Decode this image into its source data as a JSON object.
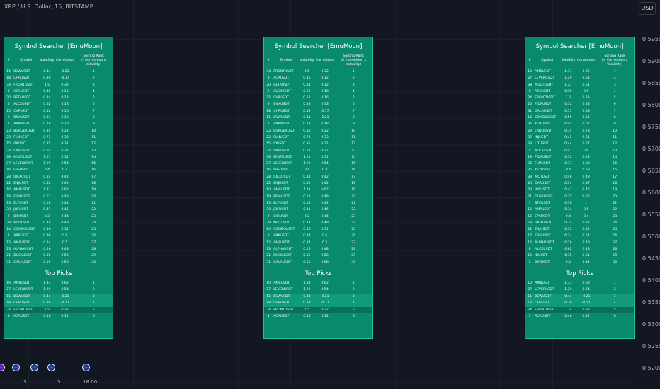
{
  "header": {
    "title": "XRP / U.S. Dollar, 15, BITSTAMP",
    "currency": "USD"
  },
  "price_axis": [
    "0.59500",
    "0.59000",
    "0.58500",
    "0.58000",
    "0.57500",
    "0.57000",
    "0.56500",
    "0.56000",
    "0.55500",
    "0.55000",
    "0.54500",
    "0.54000",
    "0.53500",
    "0.53000",
    "0.52500",
    "0.52000"
  ],
  "time_axis": [
    "3",
    "5",
    "18:00"
  ],
  "panels": [
    {
      "title": "Symbol Searcher [EmuMoon]",
      "cols": [
        "#",
        "Symbol",
        "Volatility",
        "Correlation",
        "Sorting Rank\n(- Correlation x Volatility)"
      ],
      "rows": [
        [
          "11",
          "BSWUSDT",
          "0.44",
          "-0.21",
          "1"
        ],
        [
          "18",
          "CHRUSDT",
          "0.39",
          "-0.17",
          "2"
        ],
        [
          "34",
          "FRONTUSDT",
          "1.5",
          "0.32",
          "3"
        ],
        [
          "3",
          "ACAUSDT",
          "0.46",
          "0.12",
          "4"
        ],
        [
          "20",
          "BETAUSDT",
          "0.34",
          "0.12",
          "5"
        ],
        [
          "6",
          "ALCXUSDT",
          "0.62",
          "0.18",
          "6"
        ],
        [
          "25",
          "CVPUSDT",
          "0.52",
          "0.16",
          "7"
        ],
        [
          "9",
          "BNXUSDT",
          "0.33",
          "0.13",
          "8"
        ],
        [
          "7",
          "ARPAUSDT",
          "0.28",
          "0.18",
          "9"
        ],
        [
          "23",
          "BURGERUSDT",
          "0.35",
          "0.22",
          "10"
        ],
        [
          "22",
          "FLMUSDT",
          "0.73",
          "0.33",
          "11"
        ],
        [
          "15",
          "IDUSDT",
          "0.35",
          "0.31",
          "12"
        ],
        [
          "24",
          "DARUSDT",
          "0.54",
          "0.37",
          "13"
        ],
        [
          "38",
          "MULTIUSDT",
          "1.21",
          "0.51",
          "14"
        ],
        [
          "27",
          "LEVERUSDT",
          "1.29",
          "0.54",
          "15"
        ],
        [
          "16",
          "EPSUSDT",
          "0.4",
          "0.4",
          "16"
        ],
        [
          "28",
          "IDEXUSDT",
          "0.34",
          "0.42",
          "17"
        ],
        [
          "22",
          "ENJUSDT",
          "0.32",
          "0.42",
          "18"
        ],
        [
          "10",
          "AMBUSDT",
          "1.33",
          "0.62",
          "19"
        ],
        [
          "19",
          "FIDAUSDT",
          "0.52",
          "0.48",
          "20"
        ],
        [
          "13",
          "ELFUSDT",
          "0.18",
          "0.41",
          "21"
        ],
        [
          "30",
          "JOEUSDT",
          "0.41",
          "0.46",
          "22"
        ],
        [
          "2",
          "BIFIUSDT",
          "0.2",
          "0.44",
          "23"
        ],
        [
          "39",
          "MOTUSDT",
          "0.48",
          "0.49",
          "24"
        ],
        [
          "14",
          "COMBOUSDT",
          "0.56",
          "0.51",
          "25"
        ],
        [
          "8",
          "ARKUSDT",
          "0.98",
          "0.6",
          "26"
        ],
        [
          "12",
          "AMPUSDT",
          "0.34",
          "0.5",
          "27"
        ],
        [
          "13",
          "ALPHAUSDT",
          "0.26",
          "0.48",
          "28"
        ],
        [
          "21",
          "DUSKUSDT",
          "0.35",
          "0.52",
          "29"
        ],
        [
          "31",
          "GALAUSDT",
          "0.55",
          "0.58",
          "30"
        ]
      ],
      "top_title": "Top Picks",
      "top": [
        [
          "10",
          "AMBUSDT",
          "1.33",
          "0.62",
          "1"
        ],
        [
          "27",
          "LEVERUSDT",
          "1.29",
          "0.54",
          "2"
        ],
        [
          "11",
          "BSWUSDT",
          "0.44",
          "-0.21",
          "3"
        ],
        [
          "18",
          "CHRUSDT",
          "0.39",
          "-0.17",
          "4"
        ],
        [
          "34",
          "FRONTUSDT",
          "1.5",
          "0.32",
          "5"
        ],
        [
          "3",
          "ACAUSDT",
          "0.46",
          "0.12",
          "6"
        ]
      ]
    },
    {
      "title": "Symbol Searcher [EmuMoon]",
      "cols": [
        "#",
        "Symbol",
        "Volatility",
        "Correlation",
        "Sorting Rank\n(0 Correlation x Volatility)"
      ],
      "rows": [
        [
          "34",
          "FRONTUSDT",
          "1.5",
          "0.32",
          "1"
        ],
        [
          "3",
          "ACAUSDT",
          "0.46",
          "0.12",
          "2"
        ],
        [
          "20",
          "BETAUSDT",
          "0.34",
          "0.12",
          "3"
        ],
        [
          "6",
          "ALCXUSDT",
          "0.62",
          "0.18",
          "4"
        ],
        [
          "25",
          "CVPUSDT",
          "0.52",
          "0.16",
          "5"
        ],
        [
          "9",
          "BNXUSDT",
          "0.33",
          "0.13",
          "6"
        ],
        [
          "18",
          "CHRUSDT",
          "0.39",
          "-0.17",
          "7"
        ],
        [
          "11",
          "BSWUSDT",
          "0.44",
          "-0.21",
          "8"
        ],
        [
          "7",
          "ARPAUSDT",
          "0.28",
          "0.18",
          "9"
        ],
        [
          "23",
          "BURGERUSDT",
          "0.35",
          "0.22",
          "10"
        ],
        [
          "22",
          "FLMUSDT",
          "0.73",
          "0.33",
          "11"
        ],
        [
          "15",
          "IDUSDT",
          "0.35",
          "0.31",
          "12"
        ],
        [
          "24",
          "DARUSDT",
          "0.54",
          "0.37",
          "13"
        ],
        [
          "38",
          "MULTIUSDT",
          "1.21",
          "0.51",
          "14"
        ],
        [
          "27",
          "LEVERUSDT",
          "1.29",
          "0.54",
          "15"
        ],
        [
          "16",
          "EPSUSDT",
          "0.4",
          "0.4",
          "16"
        ],
        [
          "28",
          "IDEXUSDT",
          "0.34",
          "0.42",
          "17"
        ],
        [
          "22",
          "ENJUSDT",
          "0.32",
          "0.42",
          "18"
        ],
        [
          "10",
          "AMBUSDT",
          "1.33",
          "0.62",
          "19"
        ],
        [
          "19",
          "FIDAUSDT",
          "0.52",
          "0.48",
          "20"
        ],
        [
          "13",
          "ELFUSDT",
          "0.18",
          "0.41",
          "21"
        ],
        [
          "30",
          "JOEUSDT",
          "0.41",
          "0.46",
          "22"
        ],
        [
          "2",
          "BIFIUSDT",
          "0.2",
          "0.44",
          "23"
        ],
        [
          "39",
          "MOTUSDT",
          "0.48",
          "0.49",
          "24"
        ],
        [
          "14",
          "COMBOUSDT",
          "0.56",
          "0.51",
          "25"
        ],
        [
          "8",
          "ARKUSDT",
          "0.98",
          "0.6",
          "26"
        ],
        [
          "12",
          "AMPUSDT",
          "0.34",
          "0.5",
          "27"
        ],
        [
          "13",
          "ALPHAUSDT",
          "0.26",
          "0.48",
          "28"
        ],
        [
          "21",
          "DUSKUSDT",
          "0.35",
          "0.52",
          "29"
        ],
        [
          "31",
          "GALAUSDT",
          "0.55",
          "0.58",
          "30"
        ]
      ],
      "top_title": "Top Picks",
      "top": [
        [
          "10",
          "AMBUSDT",
          "1.33",
          "0.62",
          "1"
        ],
        [
          "27",
          "LEVERUSDT",
          "1.29",
          "0.54",
          "2"
        ],
        [
          "11",
          "BSWUSDT",
          "0.44",
          "-0.21",
          "3"
        ],
        [
          "18",
          "CHRUSDT",
          "0.39",
          "-0.17",
          "4"
        ],
        [
          "34",
          "FRONTUSDT",
          "1.5",
          "0.32",
          "5"
        ],
        [
          "3",
          "ACAUSDT",
          "0.46",
          "0.12",
          "6"
        ]
      ]
    },
    {
      "title": "Symbol Searcher [EmuMoon]",
      "cols": [
        "#",
        "Symbol",
        "Volatility",
        "Correlation",
        "Sorting Rank\n(+ Correlation x Volatility)"
      ],
      "rows": [
        [
          "10",
          "AMBUSDT",
          "1.33",
          "0.62",
          "1"
        ],
        [
          "27",
          "LEVERUSDT",
          "1.29",
          "0.54",
          "2"
        ],
        [
          "38",
          "MULTIUSDT",
          "1.21",
          "0.51",
          "3"
        ],
        [
          "8",
          "ARKUSDT",
          "0.98",
          "0.6",
          "4"
        ],
        [
          "34",
          "FRONTUSDT",
          "1.5",
          "0.32",
          "5"
        ],
        [
          "25",
          "FIDAUSDT",
          "0.52",
          "0.48",
          "6"
        ],
        [
          "31",
          "GALAUSDT",
          "0.55",
          "0.58",
          "7"
        ],
        [
          "14",
          "COMBOUSDT",
          "0.56",
          "0.51",
          "8"
        ],
        [
          "36",
          "KDAUSDT",
          "0.44",
          "0.61",
          "9"
        ],
        [
          "29",
          "LADOUSDT",
          "0.35",
          "0.73",
          "10"
        ],
        [
          "37",
          "INJUSDT",
          "0.42",
          "0.61",
          "11"
        ],
        [
          "33",
          "LITUSDT",
          "0.44",
          "0.57",
          "12"
        ],
        [
          "5",
          "ALICEUSDT",
          "0.41",
          "0.6",
          "13"
        ],
        [
          "19",
          "FIDAUSDT",
          "0.52",
          "0.48",
          "14"
        ],
        [
          "32",
          "FLMUSDT",
          "0.73",
          "0.33",
          "15"
        ],
        [
          "26",
          "KEYUSDT",
          "0.4",
          "0.58",
          "16"
        ],
        [
          "39",
          "MOTUSDT",
          "0.48",
          "0.49",
          "17"
        ],
        [
          "24",
          "DARUSDT",
          "0.54",
          "0.37",
          "18"
        ],
        [
          "30",
          "JOEUSDT",
          "0.41",
          "0.46",
          "19"
        ],
        [
          "21",
          "DUSKUSDT",
          "0.35",
          "0.52",
          "20"
        ],
        [
          "1",
          "BTCUSDT",
          "0.18",
          "1",
          "21"
        ],
        [
          "12",
          "AMPUSDT",
          "0.34",
          "0.5",
          "22"
        ],
        [
          "16",
          "EPSUSDT",
          "0.4",
          "0.4",
          "23"
        ],
        [
          "28",
          "IDEXUSDT",
          "0.34",
          "0.42",
          "24"
        ],
        [
          "22",
          "ENJUSDT",
          "0.32",
          "0.42",
          "25"
        ],
        [
          "17",
          "ERNUSDT",
          "0.24",
          "0.54",
          "26"
        ],
        [
          "13",
          "ALPHAUSDT",
          "0.26",
          "0.48",
          "27"
        ],
        [
          "6",
          "ALCXUSDT",
          "0.62",
          "0.18",
          "28"
        ],
        [
          "15",
          "IDUSDT",
          "0.35",
          "0.31",
          "29"
        ],
        [
          "2",
          "BIFIUSDT",
          "0.2",
          "0.44",
          "30"
        ]
      ],
      "top_title": "Top Picks",
      "top": [
        [
          "10",
          "AMBUSDT",
          "1.33",
          "0.62",
          "1"
        ],
        [
          "27",
          "LEVERUSDT",
          "1.29",
          "0.54",
          "2"
        ],
        [
          "11",
          "BSWUSDT",
          "0.44",
          "-0.21",
          "3"
        ],
        [
          "18",
          "CHRUSDT",
          "0.39",
          "-0.17",
          "4"
        ],
        [
          "34",
          "FRONTUSDT",
          "1.5",
          "0.32",
          "5"
        ],
        [
          "3",
          "ACAUSDT",
          "0.46",
          "0.12",
          "6"
        ]
      ]
    }
  ]
}
